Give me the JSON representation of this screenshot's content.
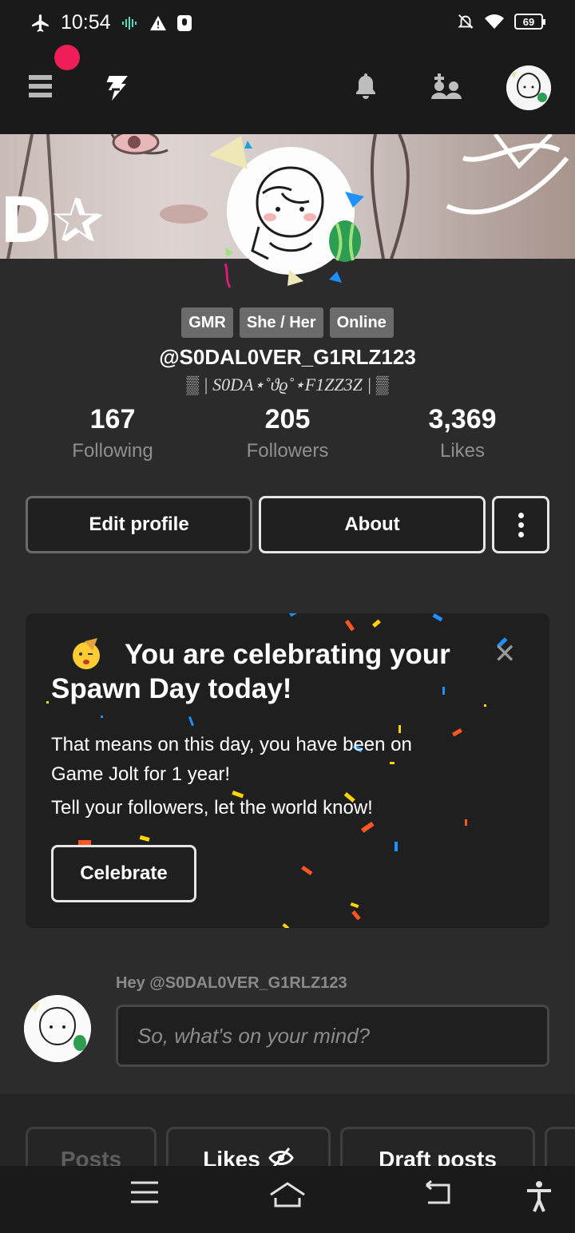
{
  "status_bar": {
    "time": "10:54",
    "battery": "69"
  },
  "header": {
    "icons": [
      "menu-icon",
      "gamejolt-logo",
      "bell-icon",
      "friends-icon",
      "avatar"
    ]
  },
  "profile": {
    "tags": [
      "GMR",
      "She / Her",
      "Online"
    ],
    "username": "@S0DAL0VER_G1RLZ123",
    "display_name": "▒ | S0DA⋆˚ϑϱ˚⋆F1ZZ3Z | ▒",
    "stats": [
      {
        "value": "167",
        "label": "Following"
      },
      {
        "value": "205",
        "label": "Followers"
      },
      {
        "value": "3,369",
        "label": "Likes"
      }
    ],
    "buttons": {
      "edit": "Edit profile",
      "about": "About"
    }
  },
  "spawn_card": {
    "title_line1": "You are celebrating your",
    "title_line2": "Spawn Day today!",
    "text1": "That means on this day, you have been on Game Jolt for 1 year!",
    "text2": "Tell your followers, let the world know!",
    "button": "Celebrate"
  },
  "post_box": {
    "greeting": "Hey @S0DAL0VER_G1RLZ123",
    "placeholder": "So, what's on your mind?"
  },
  "tabs": [
    {
      "label": "Posts"
    },
    {
      "label": "Likes"
    },
    {
      "label": "Draft posts"
    }
  ]
}
